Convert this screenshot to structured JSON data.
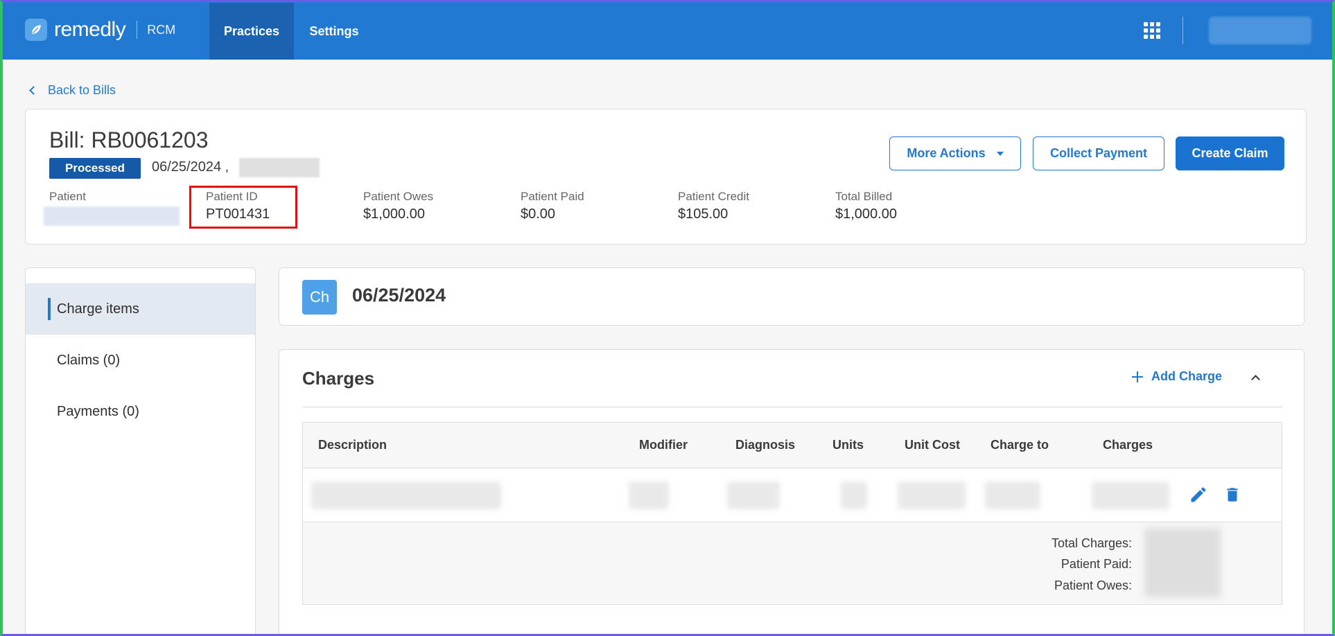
{
  "app": {
    "brand": "remedly",
    "product": "RCM",
    "nav": [
      {
        "label": "Practices",
        "active": true
      },
      {
        "label": "Settings",
        "active": false
      }
    ],
    "accent": "#2179d2"
  },
  "back_link": "Back to Bills",
  "bill": {
    "title": "Bill: RB0061203",
    "status": "Processed",
    "date": "06/25/2024 ,",
    "actions": {
      "more": "More Actions",
      "collect": "Collect Payment",
      "create": "Create Claim"
    },
    "stats": [
      {
        "label": "Patient",
        "value": ""
      },
      {
        "label": "Patient ID",
        "value": "PT001431"
      },
      {
        "label": "Patient Owes",
        "value": "$1,000.00"
      },
      {
        "label": "Patient Paid",
        "value": "$0.00"
      },
      {
        "label": "Patient Credit",
        "value": "$105.00"
      },
      {
        "label": "Total Billed",
        "value": "$1,000.00"
      }
    ]
  },
  "sidebar": {
    "items": [
      {
        "label": "Charge items",
        "active": true
      },
      {
        "label": "Claims (0)",
        "active": false
      },
      {
        "label": "Payments (0)",
        "active": false
      }
    ]
  },
  "date_card": {
    "badge": "Ch",
    "title": "06/25/2024"
  },
  "charges": {
    "title": "Charges",
    "add_label": "Add Charge",
    "columns": [
      "Description",
      "Modifier",
      "Diagnosis",
      "Units",
      "Unit Cost",
      "Charge to",
      "Charges"
    ],
    "totals": {
      "total_charges": "Total Charges:",
      "patient_paid": "Patient Paid:",
      "patient_owes": "Patient Owes:"
    }
  }
}
